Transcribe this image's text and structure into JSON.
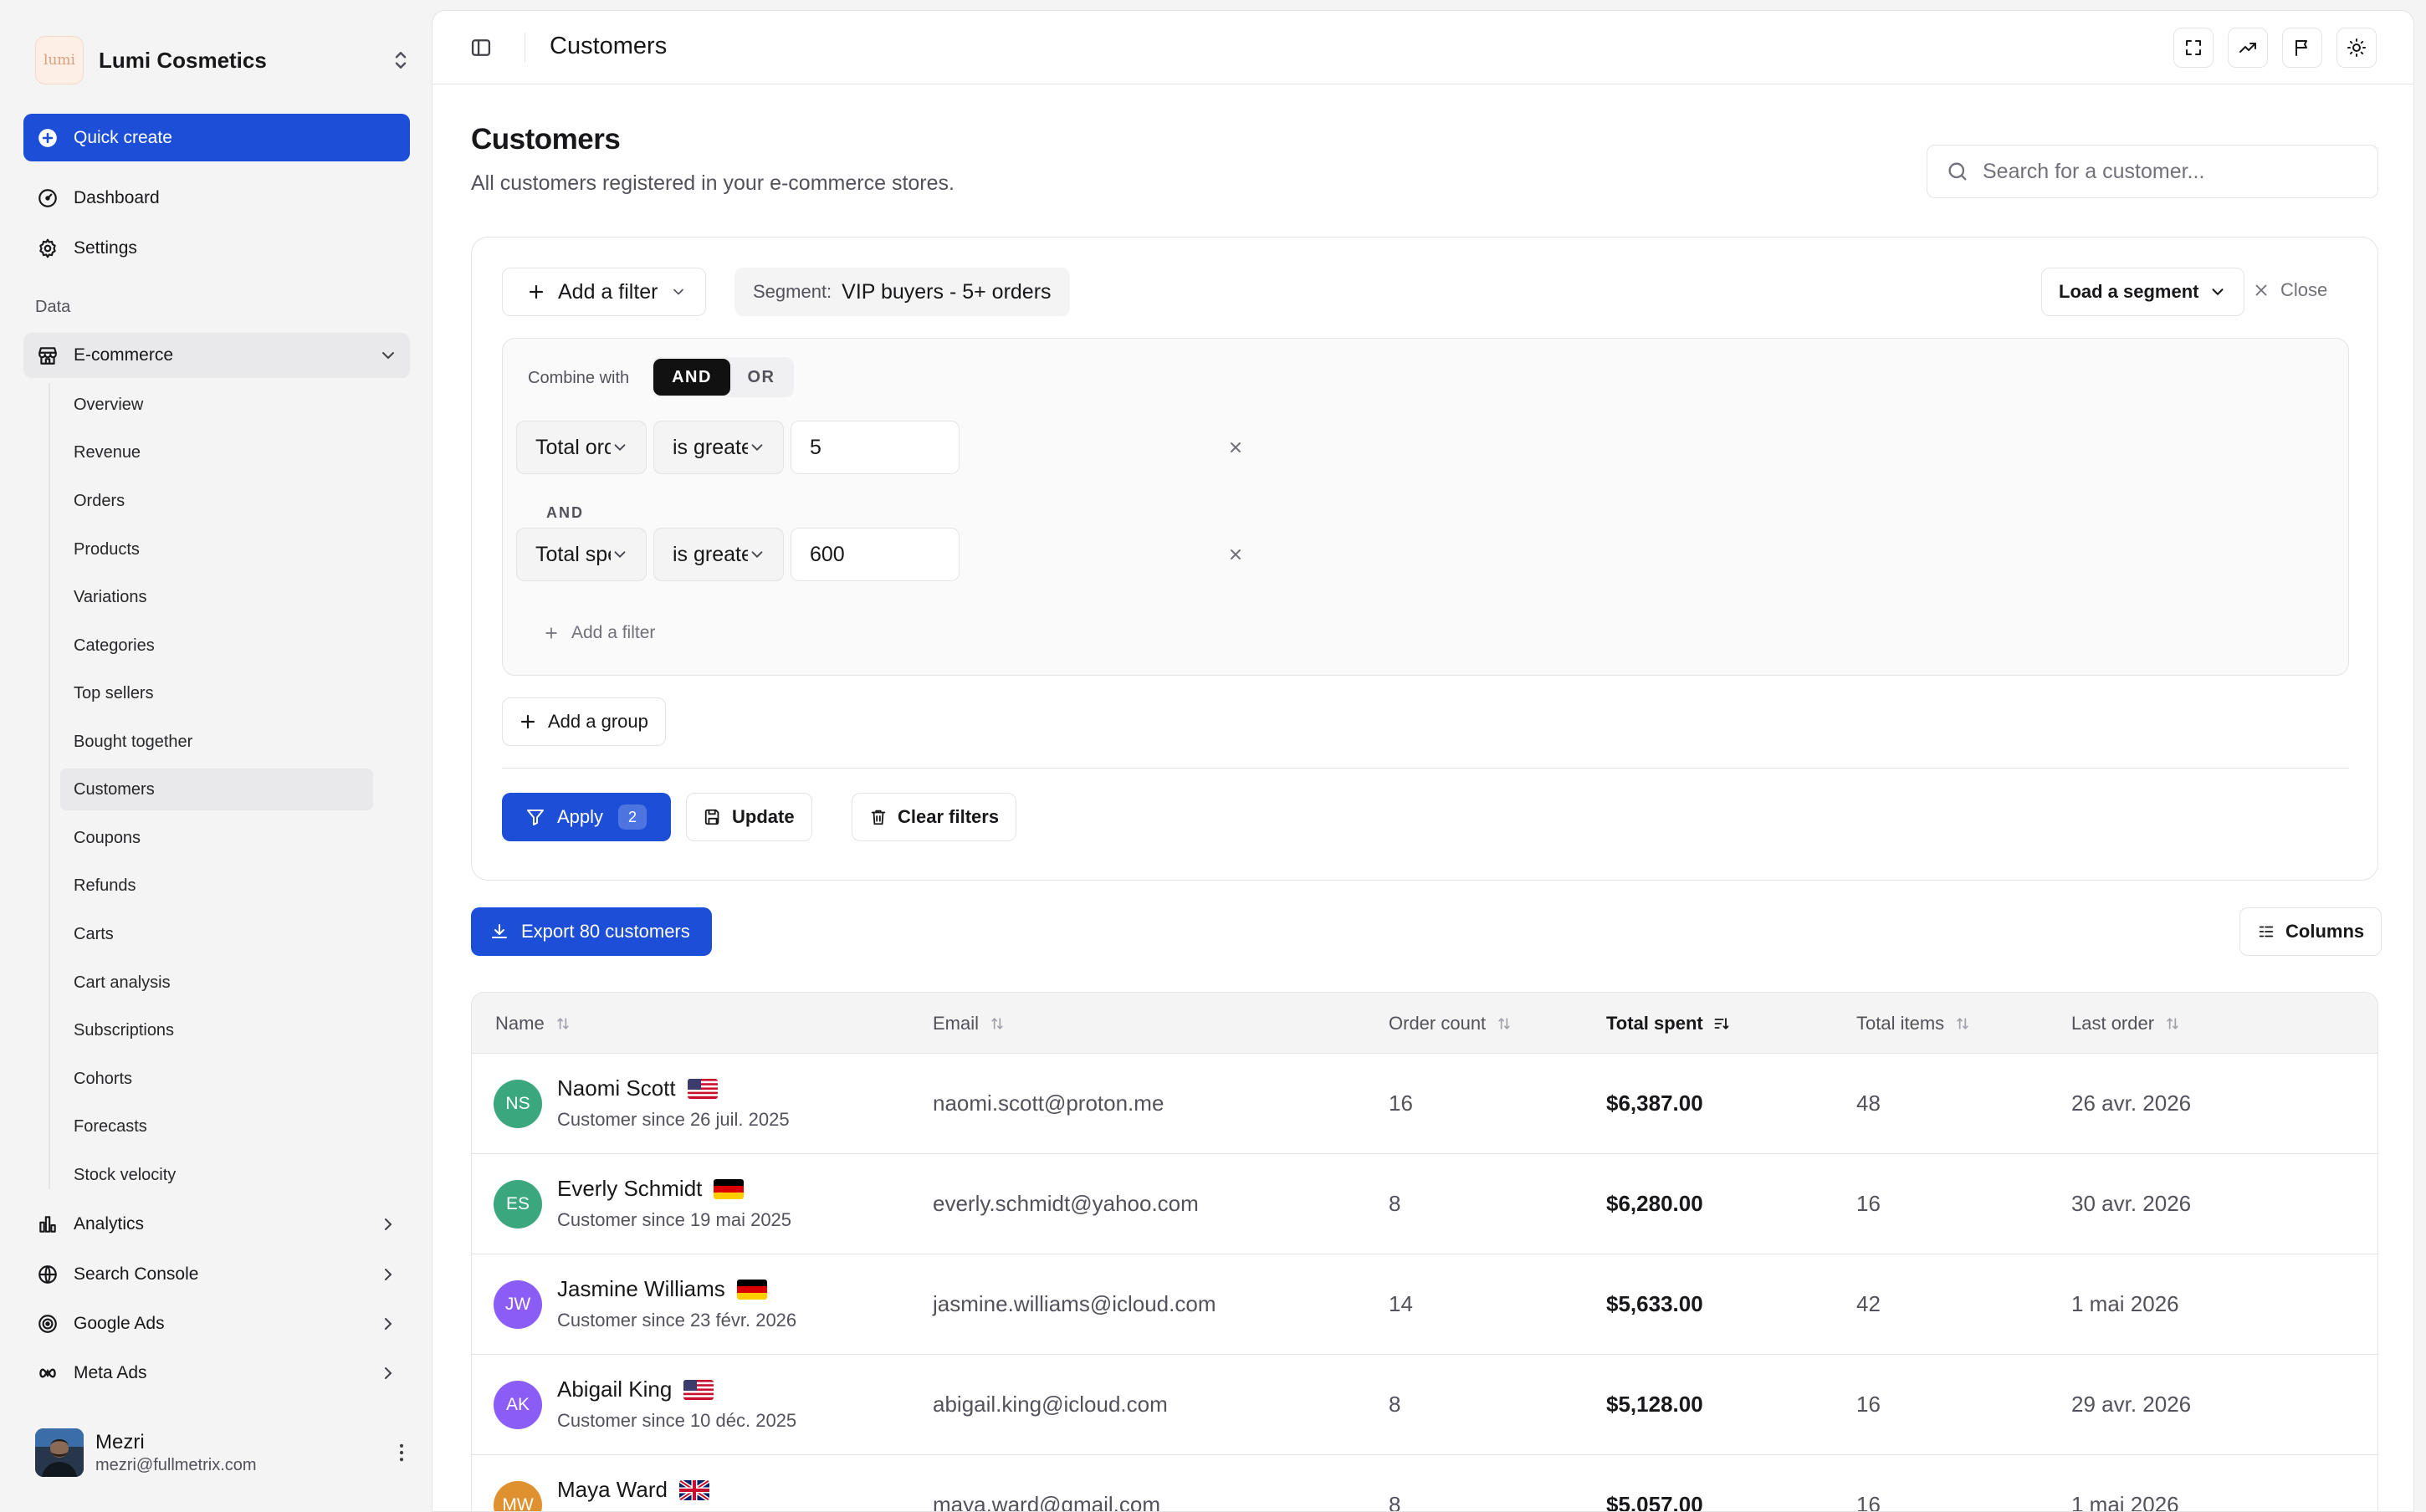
{
  "brand": {
    "logo_text": "lumi",
    "name": "Lumi Cosmetics"
  },
  "sidebar": {
    "quick_create": "Quick create",
    "top_items": [
      {
        "label": "Dashboard",
        "icon": "gauge-icon"
      },
      {
        "label": "Settings",
        "icon": "gear-icon"
      }
    ],
    "section_label": "Data",
    "ecommerce": {
      "label": "E-commerce",
      "expanded": true,
      "items": [
        "Overview",
        "Revenue",
        "Orders",
        "Products",
        "Variations",
        "Categories",
        "Top sellers",
        "Bought together",
        "Customers",
        "Coupons",
        "Refunds",
        "Carts",
        "Cart analysis",
        "Subscriptions",
        "Cohorts",
        "Forecasts",
        "Stock velocity"
      ],
      "active": "Customers"
    },
    "groups": [
      {
        "label": "Analytics",
        "icon": "bar-chart-icon"
      },
      {
        "label": "Search Console",
        "icon": "globe-icon"
      },
      {
        "label": "Google Ads",
        "icon": "target-icon"
      },
      {
        "label": "Meta Ads",
        "icon": "infinity-icon"
      }
    ],
    "user": {
      "name": "Mezri",
      "email": "mezri@fullmetrix.com"
    }
  },
  "topbar": {
    "title": "Customers"
  },
  "header": {
    "title": "Customers",
    "subtitle": "All customers registered in your e-commerce stores.",
    "search_placeholder": "Search for a customer..."
  },
  "filters": {
    "add_filter_label": "Add a filter",
    "segment_label": "Segment:",
    "segment_name": "VIP buyers - 5+ orders",
    "load_segment_label": "Load a segment",
    "close_label": "Close",
    "combine_label": "Combine with",
    "combine_options": [
      "AND",
      "OR"
    ],
    "combine_selected": "AND",
    "conditions": [
      {
        "field": "Total orders",
        "operator": "is greater than or...",
        "value": "5"
      },
      {
        "field": "Total spent",
        "operator": "is greater than or...",
        "value": "600"
      }
    ],
    "connector": "AND",
    "inner_add_filter": "Add a filter",
    "add_group_label": "Add a group",
    "apply_label": "Apply",
    "apply_count": "2",
    "update_label": "Update",
    "clear_label": "Clear filters"
  },
  "actions": {
    "export_label": "Export 80 customers",
    "columns_label": "Columns"
  },
  "table": {
    "columns": [
      "Name",
      "Email",
      "Order count",
      "Total spent",
      "Total items",
      "Last order"
    ],
    "sorted_column": "Total spent",
    "rows": [
      {
        "initials": "NS",
        "avatar_color": "#3ba77f",
        "name": "Naomi Scott",
        "flag": "us",
        "since": "Customer since 26 juil. 2025",
        "email": "naomi.scott@proton.me",
        "orders": "16",
        "spent": "$6,387.00",
        "items": "48",
        "last_order": "26 avr. 2026"
      },
      {
        "initials": "ES",
        "avatar_color": "#3ba77f",
        "name": "Everly Schmidt",
        "flag": "de",
        "since": "Customer since 19 mai 2025",
        "email": "everly.schmidt@yahoo.com",
        "orders": "8",
        "spent": "$6,280.00",
        "items": "16",
        "last_order": "30 avr. 2026"
      },
      {
        "initials": "JW",
        "avatar_color": "#8b5cf6",
        "name": "Jasmine Williams",
        "flag": "de",
        "since": "Customer since 23 févr. 2026",
        "email": "jasmine.williams@icloud.com",
        "orders": "14",
        "spent": "$5,633.00",
        "items": "42",
        "last_order": "1 mai 2026"
      },
      {
        "initials": "AK",
        "avatar_color": "#8b5cf6",
        "name": "Abigail King",
        "flag": "us",
        "since": "Customer since 10 déc. 2025",
        "email": "abigail.king@icloud.com",
        "orders": "8",
        "spent": "$5,128.00",
        "items": "16",
        "last_order": "29 avr. 2026"
      },
      {
        "initials": "MW",
        "avatar_color": "#e0912f",
        "name": "Maya Ward",
        "flag": "gb",
        "since": "",
        "email": "maya.ward@gmail.com",
        "orders": "8",
        "spent": "$5,057.00",
        "items": "16",
        "last_order": "1 mai 2026"
      }
    ]
  },
  "colors": {
    "primary": "#1d4ed8",
    "sidebar_bg": "#f4f4f5",
    "border": "#e4e4e7"
  }
}
